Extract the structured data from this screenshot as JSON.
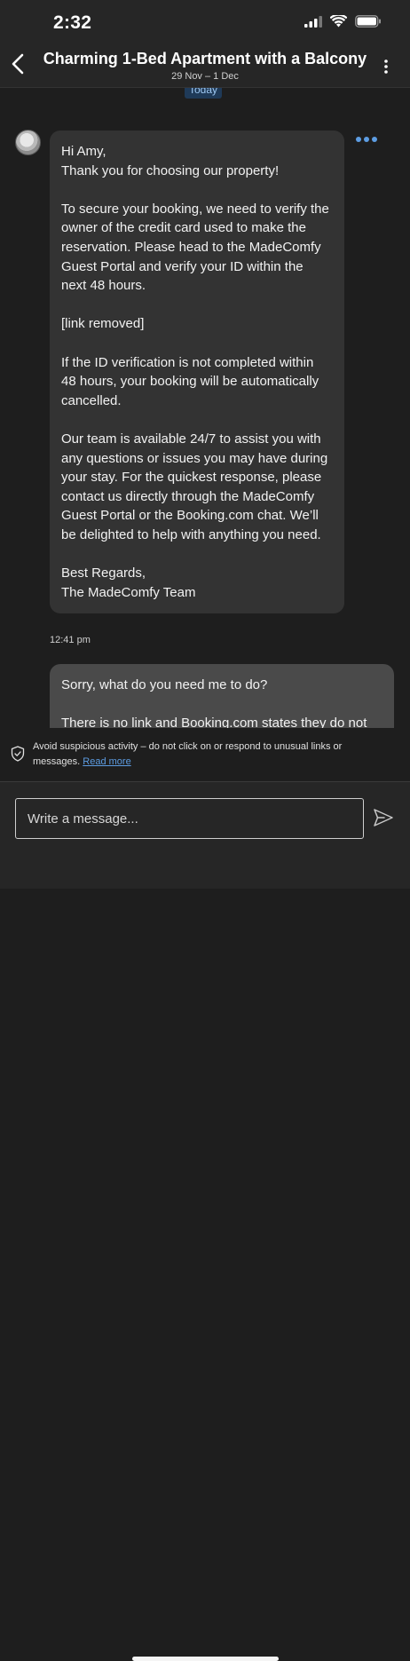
{
  "status_bar": {
    "time": "2:32"
  },
  "header": {
    "title": "Charming 1-Bed Apartment with a Balcony",
    "dates": "29 Nov – 1 Dec"
  },
  "chat": {
    "date_chip": "Today",
    "incoming_message": {
      "text": "Hi Amy,\nThank you for choosing our property!\n\nTo secure your booking, we need to verify the owner of the credit card used to make the reservation. Please head to the MadeComfy Guest Portal and verify your ID within the next 48 hours.\n\n[link removed]\n\nIf the ID verification is not completed within 48 hours, your booking will be automatically cancelled.\n\nOur team is available 24/7 to assist you with any questions or issues you may have during your stay. For the quickest response, please contact us directly through the MadeComfy Guest Portal or the Booking.com chat. We’ll be delighted to help with anything you need.\n\nBest Regards,\nThe MadeComfy Team",
      "time": "12:41 pm"
    },
    "outgoing_message": {
      "text": "Sorry, what do you need me to do?\n\nThere is no link and Booking.com states they do not"
    }
  },
  "warning": {
    "text": "Avoid suspicious activity – do not click on or respond to unusual links or messages.",
    "link": "Read more"
  },
  "composer": {
    "placeholder": "Write a message..."
  },
  "icons": {
    "back": "chevron-left-icon",
    "more": "more-vertical-icon",
    "options": "more-horizontal-icon",
    "shield": "shield-check-icon",
    "send": "send-icon",
    "signal": "signal-icon",
    "wifi": "wifi-icon",
    "battery": "battery-icon"
  },
  "colors": {
    "accent": "#5d9de3",
    "today_chip_bg": "#1f3a58",
    "incoming_bubble": "#333333",
    "outgoing_bubble": "#4a4a4a"
  }
}
